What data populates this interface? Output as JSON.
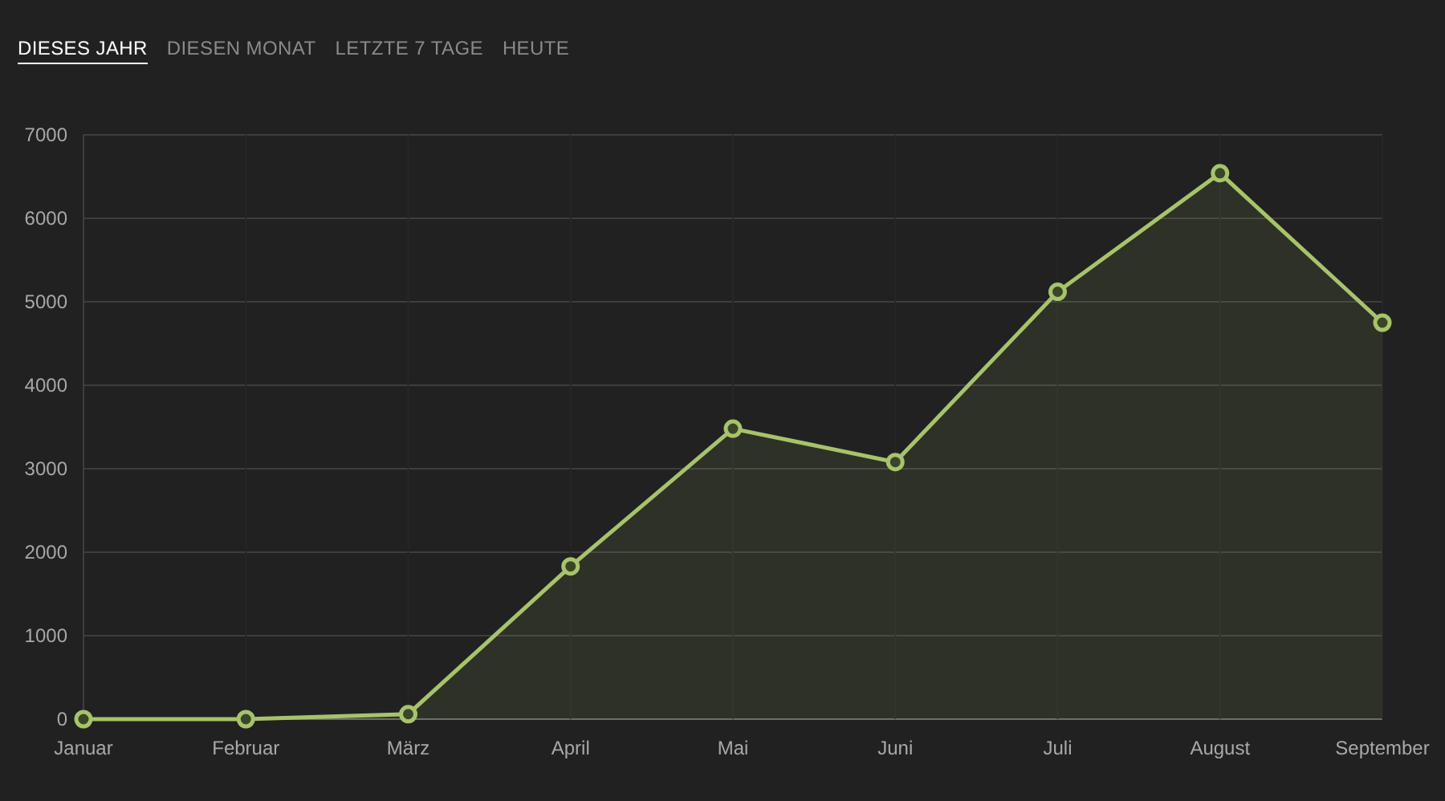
{
  "tabs": [
    {
      "label": "DIESES JAHR",
      "selected": true
    },
    {
      "label": "DIESEN MONAT",
      "selected": false
    },
    {
      "label": "LETZTE 7 TAGE",
      "selected": false
    },
    {
      "label": "HEUTE",
      "selected": false
    }
  ],
  "chart_data": {
    "type": "area",
    "grid": true,
    "categories": [
      "Januar",
      "Februar",
      "März",
      "April",
      "Mai",
      "Juni",
      "Juli",
      "August",
      "September"
    ],
    "values": [
      0,
      0,
      60,
      1830,
      3480,
      3080,
      5120,
      6540,
      4750
    ],
    "ylim": [
      0,
      7000
    ],
    "yticks": [
      0,
      1000,
      2000,
      3000,
      4000,
      5000,
      6000,
      7000
    ]
  }
}
